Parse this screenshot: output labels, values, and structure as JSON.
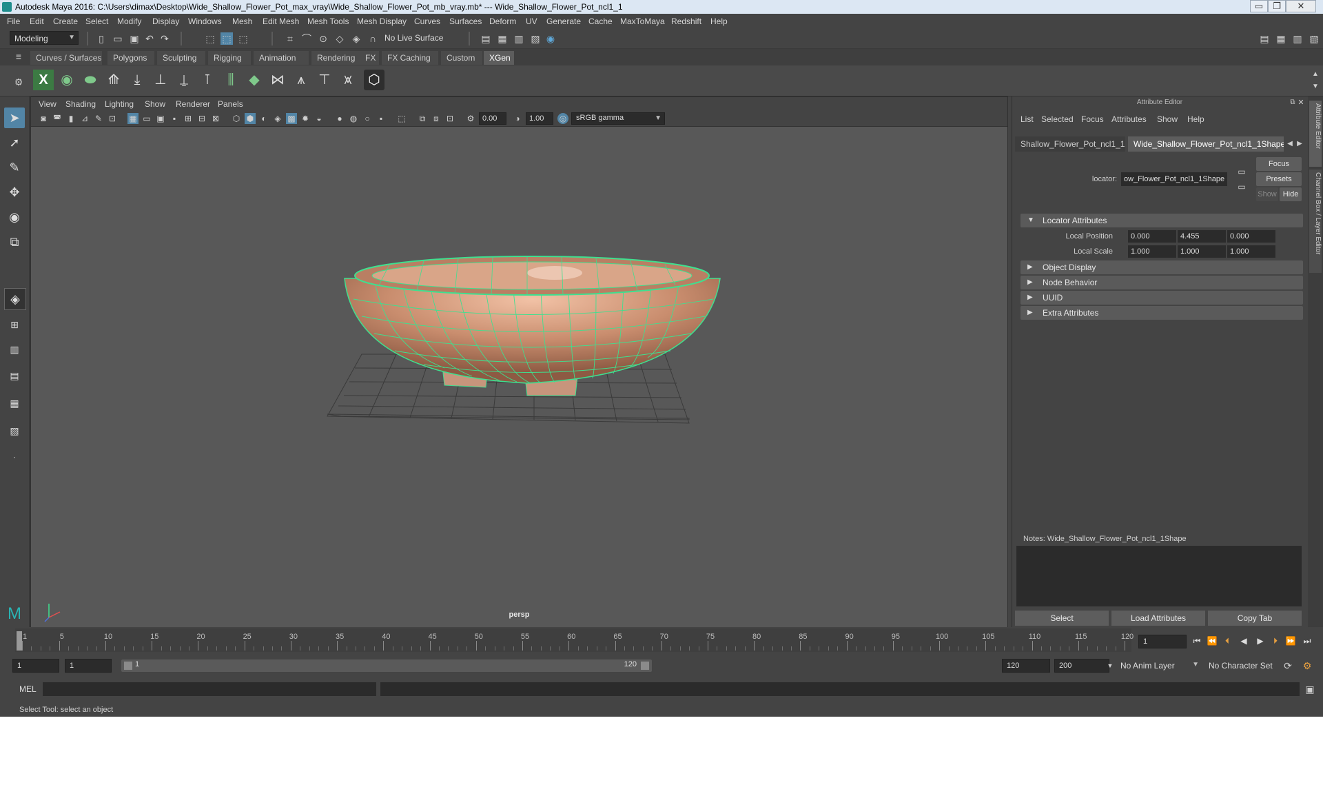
{
  "title_bar": {
    "text": "Autodesk Maya 2016: C:\\Users\\dimax\\Desktop\\Wide_Shallow_Flower_Pot_max_vray\\Wide_Shallow_Flower_Pot_mb_vray.mb*   ---   Wide_Shallow_Flower_Pot_ncl1_1",
    "minimize": "▭",
    "maximize": "❐",
    "close": "✕"
  },
  "menu": [
    "File",
    "Edit",
    "Create",
    "Select",
    "Modify",
    "Display",
    "Windows",
    "Mesh",
    "Edit Mesh",
    "Mesh Tools",
    "Mesh Display",
    "Curves",
    "Surfaces",
    "Deform",
    "UV",
    "Generate",
    "Cache",
    "MaxToMaya",
    "Redshift",
    "Help"
  ],
  "status_line": {
    "mode": "Modeling",
    "live_surface": "No Live Surface"
  },
  "shelf_tabs": [
    "Curves / Surfaces",
    "Polygons",
    "Sculpting",
    "Rigging",
    "Animation",
    "Rendering",
    "FX",
    "FX Caching",
    "Custom",
    "XGen"
  ],
  "active_shelf_tab": "XGen",
  "viewport": {
    "menu": [
      "View",
      "Shading",
      "Lighting",
      "Show",
      "Renderer",
      "Panels"
    ],
    "exposure": "0.00",
    "gamma": "1.00",
    "color_space": "sRGB gamma",
    "camera_label": "persp"
  },
  "attribute_editor": {
    "title": "Attribute Editor",
    "menu": [
      "List",
      "Selected",
      "Focus",
      "Attributes",
      "Show",
      "Help"
    ],
    "tabs": [
      "Shallow_Flower_Pot_ncl1_1",
      "Wide_Shallow_Flower_Pot_ncl1_1Shape"
    ],
    "locator_label": "locator:",
    "locator_value": "ow_Flower_Pot_ncl1_1Shape",
    "focus_btn": "Focus",
    "presets_btn": "Presets",
    "show_btn": "Show",
    "hide_btn": "Hide",
    "sections": {
      "locator_attributes": "Locator Attributes",
      "object_display": "Object Display",
      "node_behavior": "Node Behavior",
      "uuid": "UUID",
      "extra_attributes": "Extra Attributes"
    },
    "local_position_label": "Local Position",
    "local_position": [
      "0.000",
      "4.455",
      "0.000"
    ],
    "local_scale_label": "Local Scale",
    "local_scale": [
      "1.000",
      "1.000",
      "1.000"
    ],
    "notes": "Notes:  Wide_Shallow_Flower_Pot_ncl1_1Shape",
    "bottom_buttons": [
      "Select",
      "Load Attributes",
      "Copy Tab"
    ]
  },
  "side_tabs": [
    "Attribute Editor",
    "Channel Box / Layer Editor"
  ],
  "timeline": {
    "ticks": [
      1,
      5,
      10,
      15,
      20,
      25,
      30,
      35,
      40,
      45,
      50,
      55,
      60,
      65,
      70,
      75,
      80,
      85,
      90,
      95,
      100,
      105,
      110,
      115,
      120
    ],
    "current_frame": "1",
    "range_start": "1",
    "range_start_inner": "1",
    "slider_start": "1",
    "slider_end": "120",
    "range_end": "120",
    "range_end_outer": "200",
    "anim_layer": "No Anim Layer",
    "character_set": "No Character Set"
  },
  "command_line": {
    "lang": "MEL"
  },
  "help_line": "Select Tool: select an object",
  "colors": {
    "accent": "#5285a6",
    "wireframe": "#3ee08f",
    "pot": "#c98d6e",
    "active_tab": "#5d5d5d"
  }
}
